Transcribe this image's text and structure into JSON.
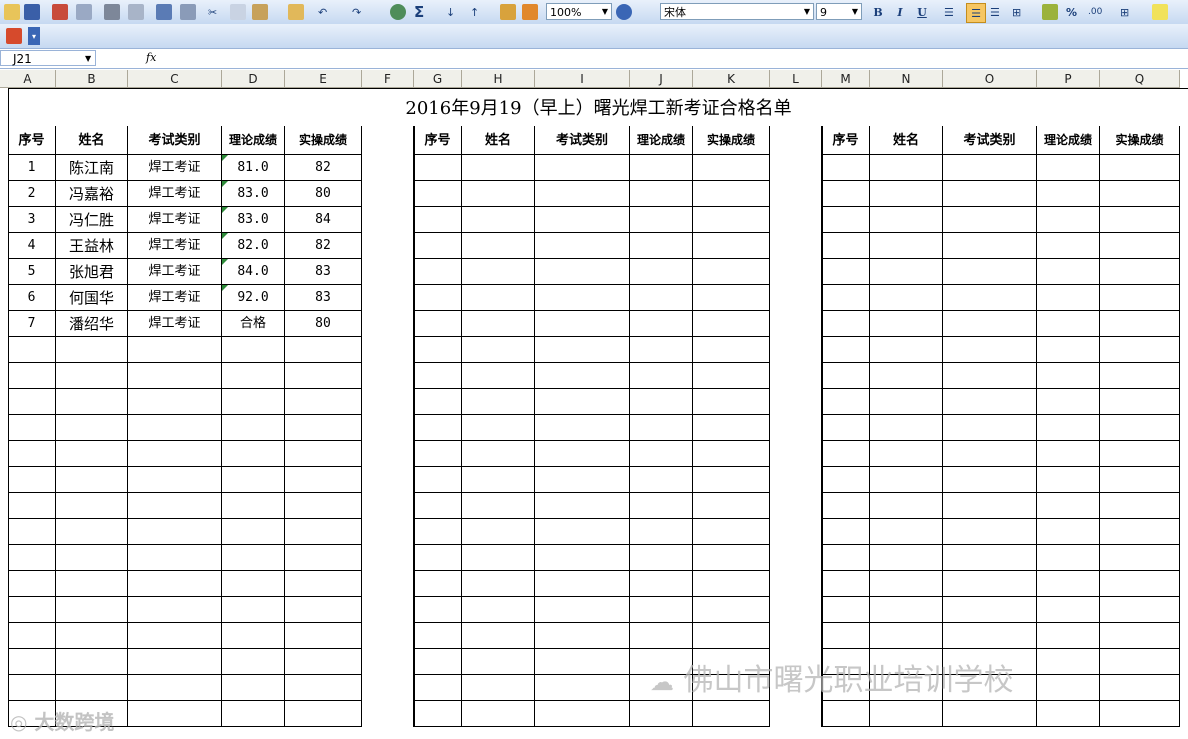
{
  "toolbar": {
    "zoom": "100%",
    "font_name": "宋体",
    "font_size": "9",
    "bold_label": "B",
    "italic_label": "I",
    "underline_label": "U",
    "percent_label": "%",
    "sigma_label": "Σ"
  },
  "formula_bar": {
    "cell_ref": "J21",
    "fx_label": "fx"
  },
  "column_headers": [
    "A",
    "B",
    "C",
    "D",
    "E",
    "F",
    "G",
    "H",
    "I",
    "J",
    "K",
    "L",
    "M",
    "N",
    "O",
    "P",
    "Q"
  ],
  "sheet": {
    "title": "2016年9月19（早上）曙光焊工新考证合格名单",
    "headers": [
      "序号",
      "姓名",
      "考试类别",
      "理论成绩",
      "实操成绩"
    ],
    "rows": [
      {
        "no": "1",
        "name": "陈江南",
        "type": "焊工考证",
        "theory": "81.0",
        "practice": "82"
      },
      {
        "no": "2",
        "name": "冯嘉裕",
        "type": "焊工考证",
        "theory": "83.0",
        "practice": "80"
      },
      {
        "no": "3",
        "name": "冯仁胜",
        "type": "焊工考证",
        "theory": "83.0",
        "practice": "84"
      },
      {
        "no": "4",
        "name": "王益林",
        "type": "焊工考证",
        "theory": "82.0",
        "practice": "82"
      },
      {
        "no": "5",
        "name": "张旭君",
        "type": "焊工考证",
        "theory": "84.0",
        "practice": "83"
      },
      {
        "no": "6",
        "name": "何国华",
        "type": "焊工考证",
        "theory": "92.0",
        "practice": "83"
      },
      {
        "no": "7",
        "name": "潘绍华",
        "type": "焊工考证",
        "theory": "合格",
        "practice": "80"
      }
    ]
  },
  "watermarks": {
    "school": "佛山市曙光职业培训学校",
    "corner": "大数跨境"
  }
}
